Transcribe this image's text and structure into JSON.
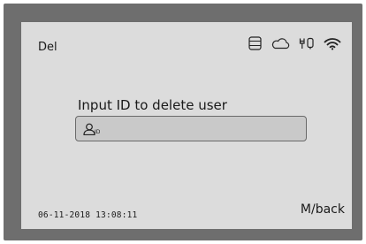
{
  "header": {
    "title": "Del",
    "status_icons": [
      "database-icon",
      "cloud-icon",
      "network-icon",
      "wifi-icon"
    ]
  },
  "main": {
    "prompt": "Input ID to delete user",
    "id_field": {
      "icon": "user-icon",
      "icon_suffix": "ID",
      "value": ""
    }
  },
  "footer": {
    "datetime": "06-11-2018 13:08:11",
    "back_label": "M/back"
  },
  "colors": {
    "frame": "#6e6e6e",
    "screen": "#dcdcdc",
    "input_bg": "#c9c9c9"
  }
}
